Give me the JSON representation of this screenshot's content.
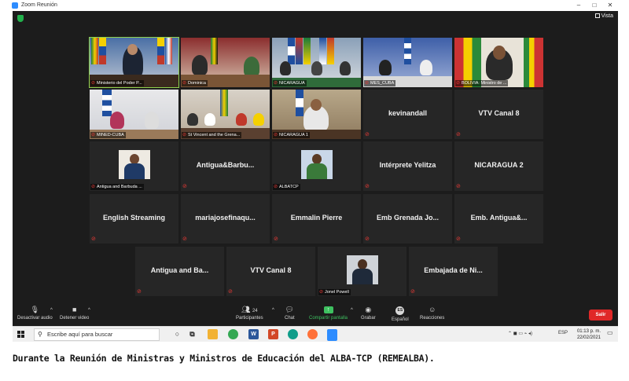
{
  "window": {
    "title": "Zoom Reunión",
    "minimize": "–",
    "maximize": "□",
    "close": "✕"
  },
  "meeting": {
    "view_label": "Vista",
    "tiles": [
      {
        "id": "t1",
        "type": "video",
        "label": "Ministerio del Poder P...",
        "active": true
      },
      {
        "id": "t2",
        "type": "video",
        "label": "Dominica"
      },
      {
        "id": "t3",
        "type": "video",
        "label": "NICARAGUA"
      },
      {
        "id": "t4",
        "type": "video",
        "label": "MES_CUBA"
      },
      {
        "id": "t5",
        "type": "video",
        "label": "BOLIVIA: Ministro de ..."
      },
      {
        "id": "t6",
        "type": "video",
        "label": "MINED-CUBA"
      },
      {
        "id": "t7",
        "type": "video",
        "label": "St Vincent and the Grena..."
      },
      {
        "id": "t8",
        "type": "video",
        "label": "NICARAGUA 1"
      },
      {
        "id": "t9",
        "type": "name",
        "name": "kevinandall"
      },
      {
        "id": "t10",
        "type": "name",
        "name": "VTV Canal 8"
      },
      {
        "id": "t11",
        "type": "avatar",
        "label": "Antigua and Barbuda ..."
      },
      {
        "id": "t12",
        "type": "name",
        "name": "Antigua&Barbu..."
      },
      {
        "id": "t13",
        "type": "avatar",
        "label": "ALBATCP"
      },
      {
        "id": "t14",
        "type": "name",
        "name": "Intérprete Yelitza"
      },
      {
        "id": "t15",
        "type": "name",
        "name": "NICARAGUA 2"
      },
      {
        "id": "t16",
        "type": "name",
        "name": "English Streaming"
      },
      {
        "id": "t17",
        "type": "name",
        "name": "mariajosefinaqu..."
      },
      {
        "id": "t18",
        "type": "name",
        "name": "Emmalin Pierre"
      },
      {
        "id": "t19",
        "type": "name",
        "name": "Emb Grenada Jo..."
      },
      {
        "id": "t20",
        "type": "name",
        "name": "Emb.  Antigua&..."
      },
      {
        "id": "t21",
        "type": "name",
        "name": "Antigua and Ba..."
      },
      {
        "id": "t22",
        "type": "name",
        "name": "VTV Canal 8"
      },
      {
        "id": "t23",
        "type": "avatar",
        "label": "Jonel Powell"
      },
      {
        "id": "t24",
        "type": "name",
        "name": "Embajada de Ni..."
      }
    ]
  },
  "toolbar": {
    "mute_label": "Desactivar audio",
    "video_label": "Detener video",
    "participants_label": "Participantes",
    "participants_count": "24",
    "chat_label": "Chat",
    "share_label": "Compartir pantalla",
    "record_label": "Grabar",
    "language_label": "Español",
    "language_badge": "ES",
    "reactions_label": "Reacciones",
    "leave_label": "Salir"
  },
  "taskbar": {
    "search_placeholder": "Escribe aquí para buscar",
    "language": "ESP",
    "time": "01:13 p. m.",
    "date": "22/02/2021"
  },
  "caption": "Durante la Reunión de Ministras y Ministros de Educación del ALBA-TCP (REMEALBA).",
  "colors": {
    "meeting_bg": "#1c1c1c",
    "tile_bg": "#262626",
    "active_speaker": "#8fd14f",
    "share_green": "#3ec160",
    "leave_red": "#e02828",
    "mic_muted": "#e53935"
  }
}
